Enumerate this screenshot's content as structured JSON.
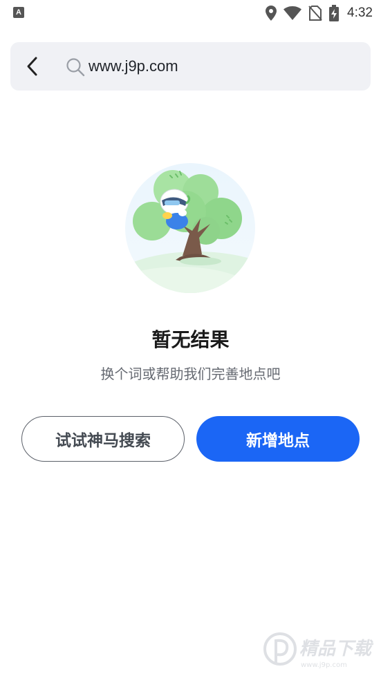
{
  "status_bar": {
    "app_badge": "A",
    "time": "4:32",
    "icons": [
      "location-icon",
      "wifi-icon",
      "no-sim-icon",
      "battery-charging-icon"
    ]
  },
  "search": {
    "query": "www.j9p.com",
    "back_icon": "chevron-left-icon",
    "search_icon": "search-icon"
  },
  "empty_state": {
    "title": "暂无结果",
    "description": "换个词或帮助我们完善地点吧",
    "illustration": "tree-with-character-illustration"
  },
  "actions": {
    "secondary_label": "试试神马搜索",
    "primary_label": "新增地点"
  },
  "watermark": {
    "text": "精品下载",
    "subtext": "www.j9p.com"
  },
  "colors": {
    "primary": "#1b66f5",
    "search_bg": "#f0f1f5",
    "tree_green": "#8fd68b"
  }
}
